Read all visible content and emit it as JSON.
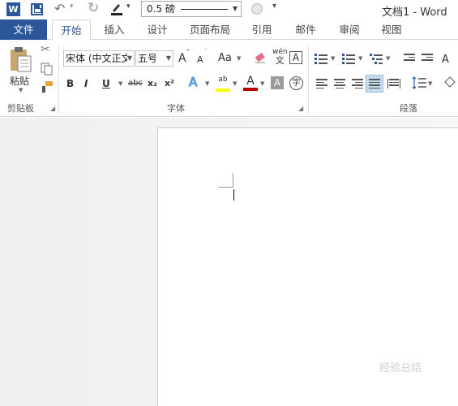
{
  "window": {
    "title": "文档1 - Word"
  },
  "qat": {
    "app_icon": "W",
    "line_weight": "0.5 磅",
    "more_symbol": "▾"
  },
  "tabs": [
    {
      "label": "文件"
    },
    {
      "label": "开始"
    },
    {
      "label": "插入"
    },
    {
      "label": "设计"
    },
    {
      "label": "页面布局"
    },
    {
      "label": "引用"
    },
    {
      "label": "邮件"
    },
    {
      "label": "审阅"
    },
    {
      "label": "视图"
    }
  ],
  "clipboard": {
    "paste_label": "粘贴",
    "group_label": "剪贴板"
  },
  "font": {
    "font_name": "宋体 (中文正文",
    "font_size": "五号",
    "grow": "A",
    "shrink": "A",
    "case": "Aa",
    "phonetic_top": "wén",
    "phonetic_bottom": "文",
    "border_char": "A",
    "bold": "B",
    "italic": "I",
    "underline": "U",
    "strike": "abc",
    "subscript": "x₂",
    "superscript": "x²",
    "effects": "A",
    "highlight": "ab",
    "font_color": "A",
    "shading": "A",
    "enclose": "字",
    "group_label": "字体"
  },
  "paragraph": {
    "group_label": "段落"
  },
  "colors": {
    "brand": "#2b579a",
    "highlight": "#ffff00",
    "font_color": "#c00000"
  },
  "watermark": "经验总结"
}
